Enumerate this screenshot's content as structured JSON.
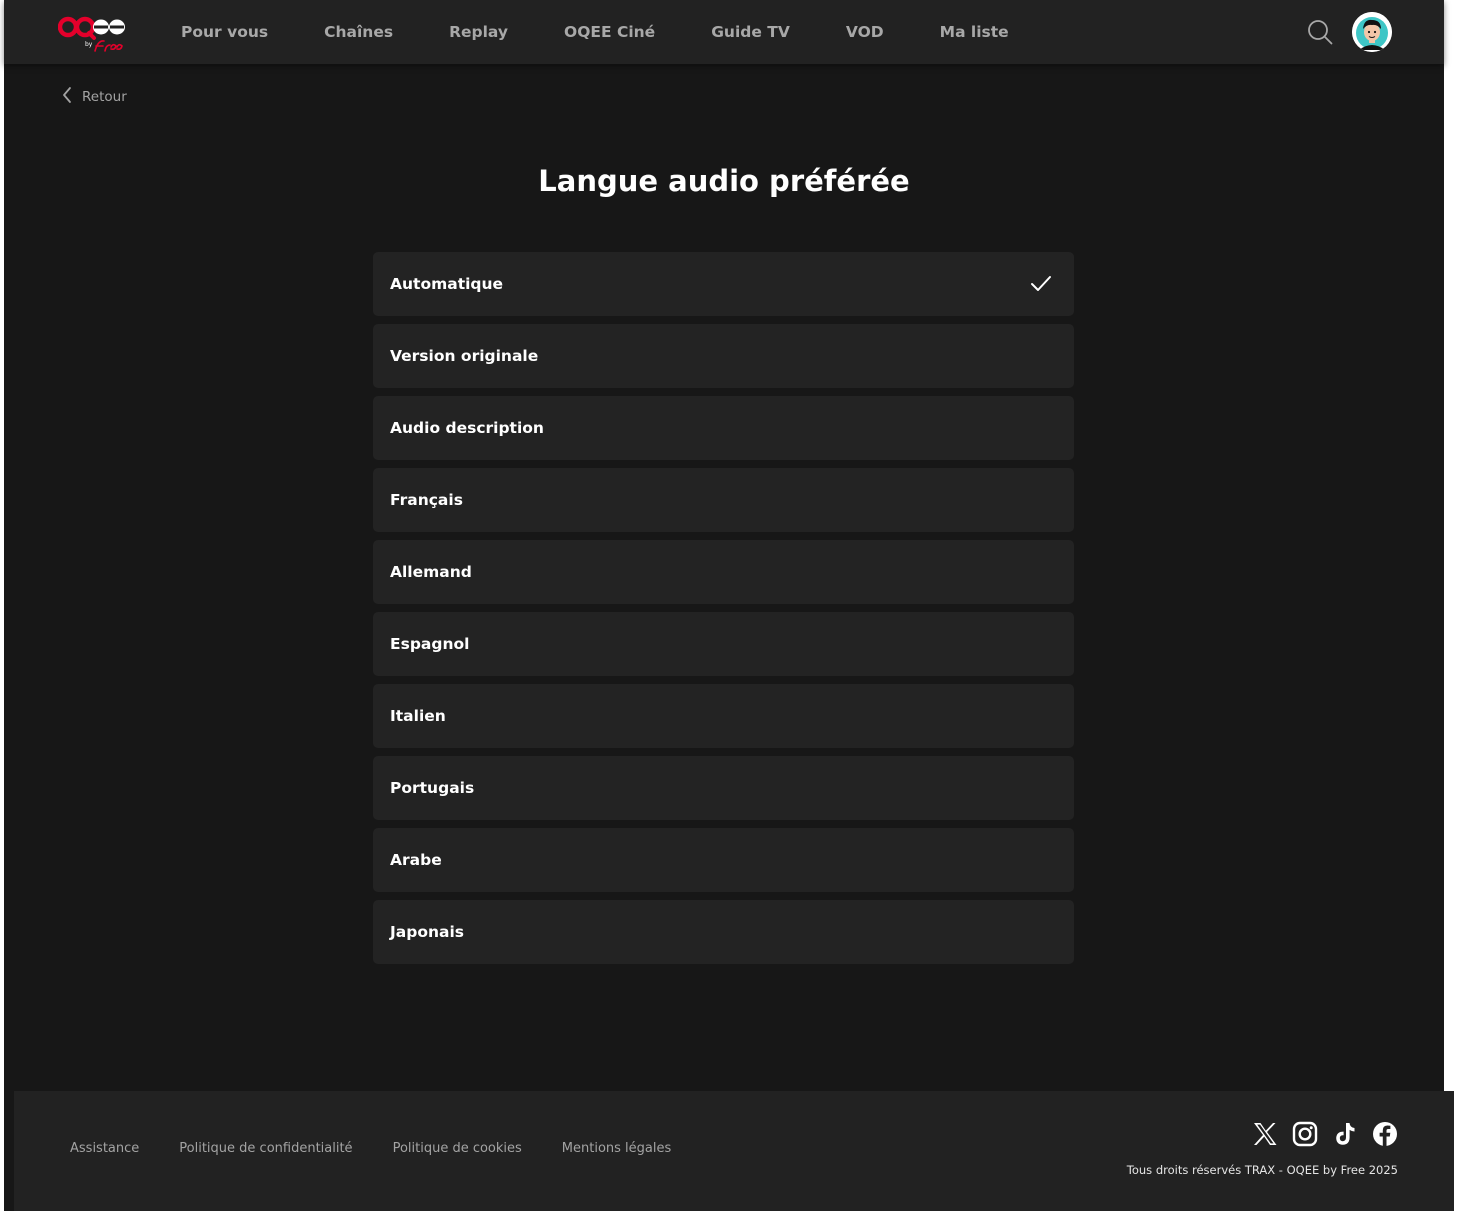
{
  "header": {
    "logo_text": "OQEE by Free",
    "nav": [
      "Pour vous",
      "Chaînes",
      "Replay",
      "OQEE Ciné",
      "Guide TV",
      "VOD",
      "Ma liste"
    ],
    "search_icon": "search-icon",
    "avatar_icon": "avatar-icon"
  },
  "back": {
    "label": "Retour",
    "icon": "chevron-left-icon"
  },
  "page": {
    "title": "Langue audio préférée"
  },
  "options": [
    {
      "label": "Automatique",
      "selected": true
    },
    {
      "label": "Version originale",
      "selected": false
    },
    {
      "label": "Audio description",
      "selected": false
    },
    {
      "label": "Français",
      "selected": false
    },
    {
      "label": "Allemand",
      "selected": false
    },
    {
      "label": "Espagnol",
      "selected": false
    },
    {
      "label": "Italien",
      "selected": false
    },
    {
      "label": "Portugais",
      "selected": false
    },
    {
      "label": "Arabe",
      "selected": false
    },
    {
      "label": "Japonais",
      "selected": false
    }
  ],
  "footer": {
    "links": [
      "Assistance",
      "Politique de confidentialité",
      "Politique de cookies",
      "Mentions légales"
    ],
    "socials": [
      "x-icon",
      "instagram-icon",
      "tiktok-icon",
      "facebook-icon"
    ],
    "copyright": "Tous droits réservés TRAX - OQEE by Free 2025"
  },
  "colors": {
    "background": "#171717",
    "header": "#222222",
    "option": "#232323",
    "brand_red": "#e4002b",
    "text": "#ffffff",
    "muted": "#a8a8a8"
  }
}
